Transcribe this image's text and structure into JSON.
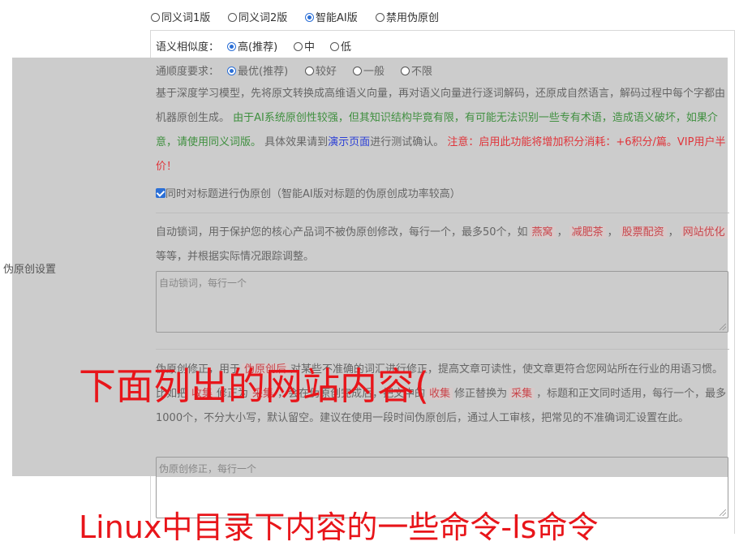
{
  "mode_options": [
    {
      "label": "同义词1版",
      "selected": false
    },
    {
      "label": "同义词2版",
      "selected": false
    },
    {
      "label": "智能AI版",
      "selected": true
    },
    {
      "label": "禁用伪原创",
      "selected": false
    }
  ],
  "similarity": {
    "label": "语义相似度：",
    "options": [
      {
        "label": "高(推荐)",
        "selected": true
      },
      {
        "label": "中",
        "selected": false
      },
      {
        "label": "低",
        "selected": false
      }
    ]
  },
  "fluency": {
    "label": "通顺度要求：",
    "options": [
      {
        "label": "最优(推荐)",
        "selected": true
      },
      {
        "label": "较好",
        "selected": false
      },
      {
        "label": "一般",
        "selected": false
      },
      {
        "label": "不限",
        "selected": false
      }
    ]
  },
  "section_label": "伪原创设置",
  "description": {
    "part1": "基于深度学习模型，先将原文转换成高维语义向量，再对语义向量进行逐词解码，还原成自然语言，解码过程中每个字都由机器原创生成。",
    "part2_green": "由于AI系统原创性较强，但其知识结构毕竟有限，有可能无法识别一些专有术语，造成语义破坏，如果介意，请使用同义词版。",
    "part3": "具体效果请到",
    "link": "演示页面",
    "part4": "进行测试确认。",
    "part5_red": "注意：启用此功能将增加积分消耗：+6积分/篇。VIP用户半价！"
  },
  "title_option": {
    "label": "同时对标题进行伪原创（智能AI版对标题的伪原创成功率较高）",
    "checked": true
  },
  "lock_words": {
    "text1": "自动锁词，用于保护您的核心产品词不被伪原创修改，每行一个，最多50个，如",
    "examples": [
      "燕窝",
      "减肥茶",
      "股票配资",
      "网站优化"
    ],
    "text2": "等等，并根据实际情况跟踪调整。",
    "placeholder": "自动锁词，每行一个"
  },
  "correction": {
    "text1": "伪原创修正，用于",
    "tag1": "伪原创后",
    "text2": "对某些不准确的词汇进行修正，提高文章可读性，使文章更符合您网站所在行业的用语习惯。比如把",
    "tag2": "收集",
    "text3": "修正为",
    "tag3": "采集",
    "text4": "，会在伪原创完成后，把文中的",
    "tag4": "收集",
    "text5": "修正替换为",
    "tag5": "采集",
    "text6": "，标题和正文同时适用，每行一个，最多1000个，不分大小写，默认留空。建议在使用一段时间伪原创后，通过人工审核，把常见的不准确词汇设置在此。",
    "placeholder": "伪原创修正，每行一个"
  },
  "overlay_texts": {
    "line1": "下面列出的网站内容(",
    "line2": "Linux中目录下内容的一些命令-ls命令"
  }
}
